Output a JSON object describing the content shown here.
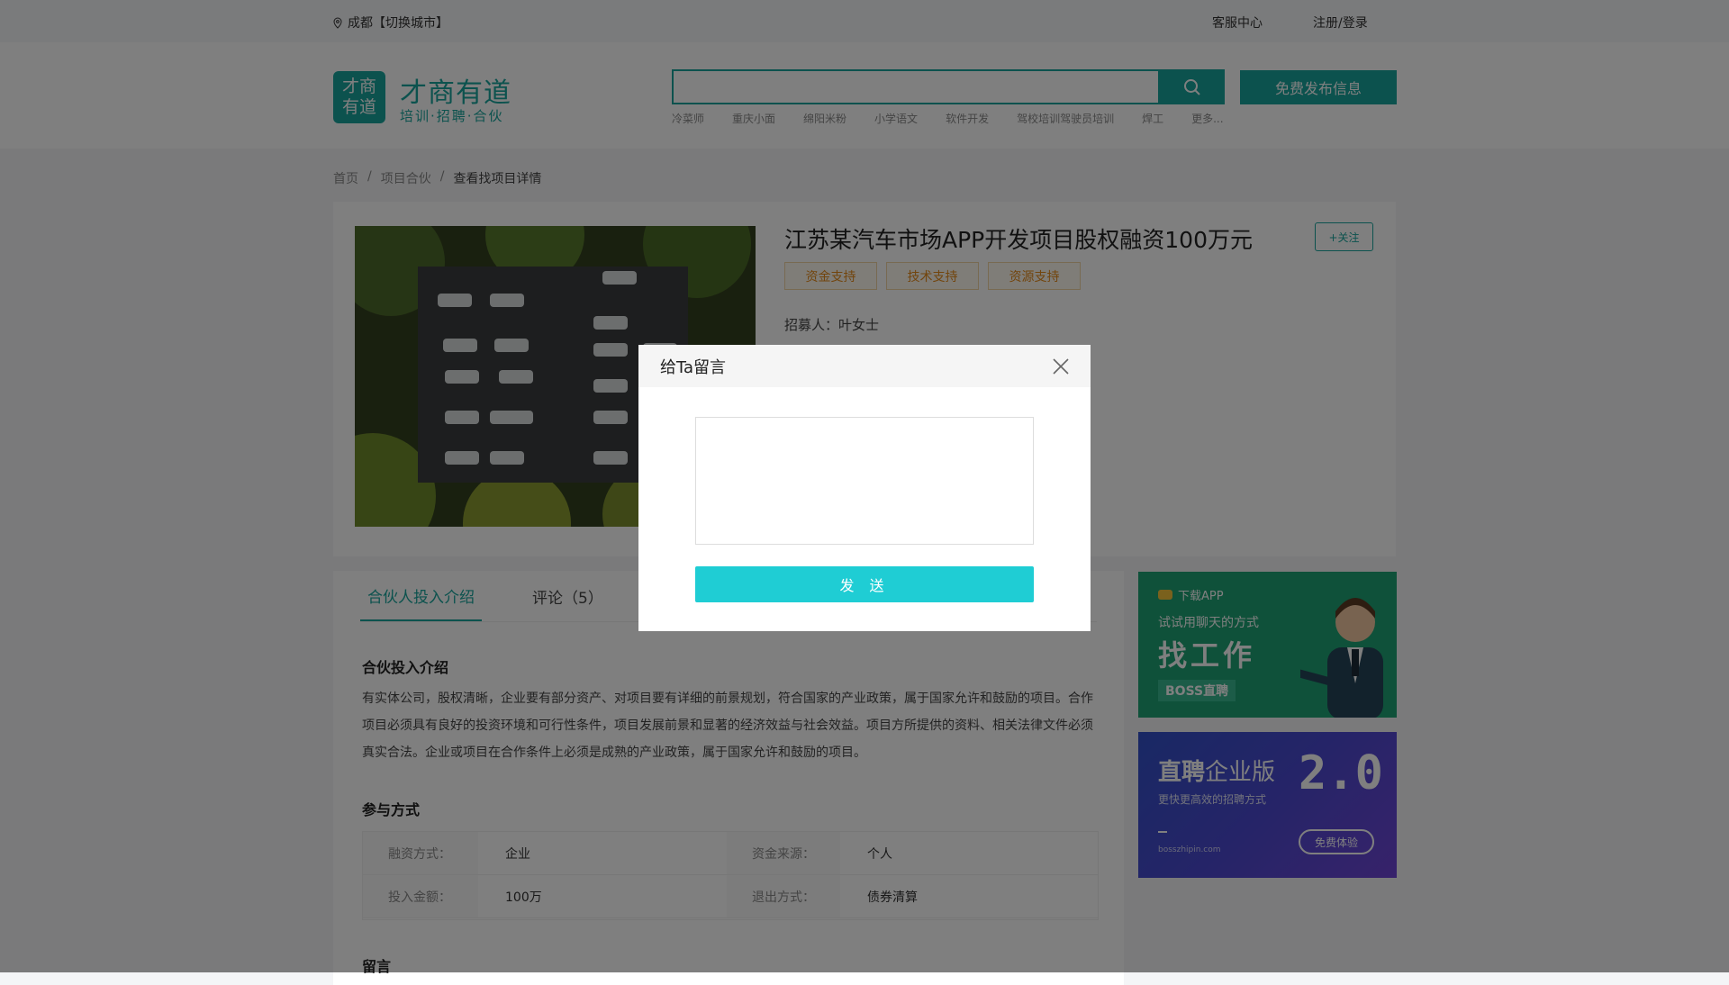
{
  "topbar": {
    "city": "成都【切换城市】",
    "service": "客服中心",
    "auth": "注册/登录"
  },
  "logo": {
    "box_line1": "才商",
    "box_line2": "有道",
    "name": "才商有道",
    "slogan": "培训·招聘·合伙"
  },
  "search": {
    "value": "",
    "publish_label": "免费发布信息",
    "hot": [
      "冷菜师",
      "重庆小面",
      "绵阳米粉",
      "小学语文",
      "软件开发",
      "驾校培训驾驶员培训",
      "焊工",
      "更多..."
    ]
  },
  "breadcrumb": [
    "首页",
    "/",
    "项目合伙",
    "/",
    "查看找项目详情"
  ],
  "project": {
    "title": "江苏某汽车市场APP开发项目股权融资100万元",
    "follow": "+关注",
    "tags": [
      "资金支持",
      "技术支持",
      "资源支持"
    ],
    "recruiter": "招募人：叶女士"
  },
  "tabs": [
    "合伙人投入介绍",
    "评论（5）"
  ],
  "intro": {
    "title": "合伙投入介绍",
    "text": "有实体公司，股权清晰，企业要有部分资产、对项目要有详细的前景规划，符合国家的产业政策，属于国家允许和鼓励的项目。合作项目必须具有良好的投资环境和可行性条件，项目发展前景和显著的经济效益与社会效益。项目方所提供的资料、相关法律文件必须真实合法。企业或项目在合作条件上必须是成熟的产业政策，属于国家允许和鼓励的项目。"
  },
  "participation": {
    "title": "参与方式",
    "rows": [
      [
        "融资方式：",
        "企业",
        "资金来源：",
        "个人"
      ],
      [
        "投入金额：",
        "100万",
        "退出方式：",
        "债券清算"
      ]
    ]
  },
  "message_section": {
    "title": "留言"
  },
  "ads": {
    "ad1": {
      "app": "下载APP",
      "line1": "试试用聊天的方式",
      "line2": "找工作",
      "brand": "BOSS直聘"
    },
    "ad2": {
      "title_a": "直聘",
      "title_b": "企业版",
      "version": "2.0",
      "sub": "更快更高效的招聘方式",
      "site": "bosszhipin.com",
      "btn": "免费体验"
    }
  },
  "modal": {
    "title": "给Ta留言",
    "textarea_value": "",
    "send": "发 送"
  },
  "colors": {
    "brand": "#19a59c",
    "send": "#1fcdd4",
    "tag": "#e48a1a"
  }
}
